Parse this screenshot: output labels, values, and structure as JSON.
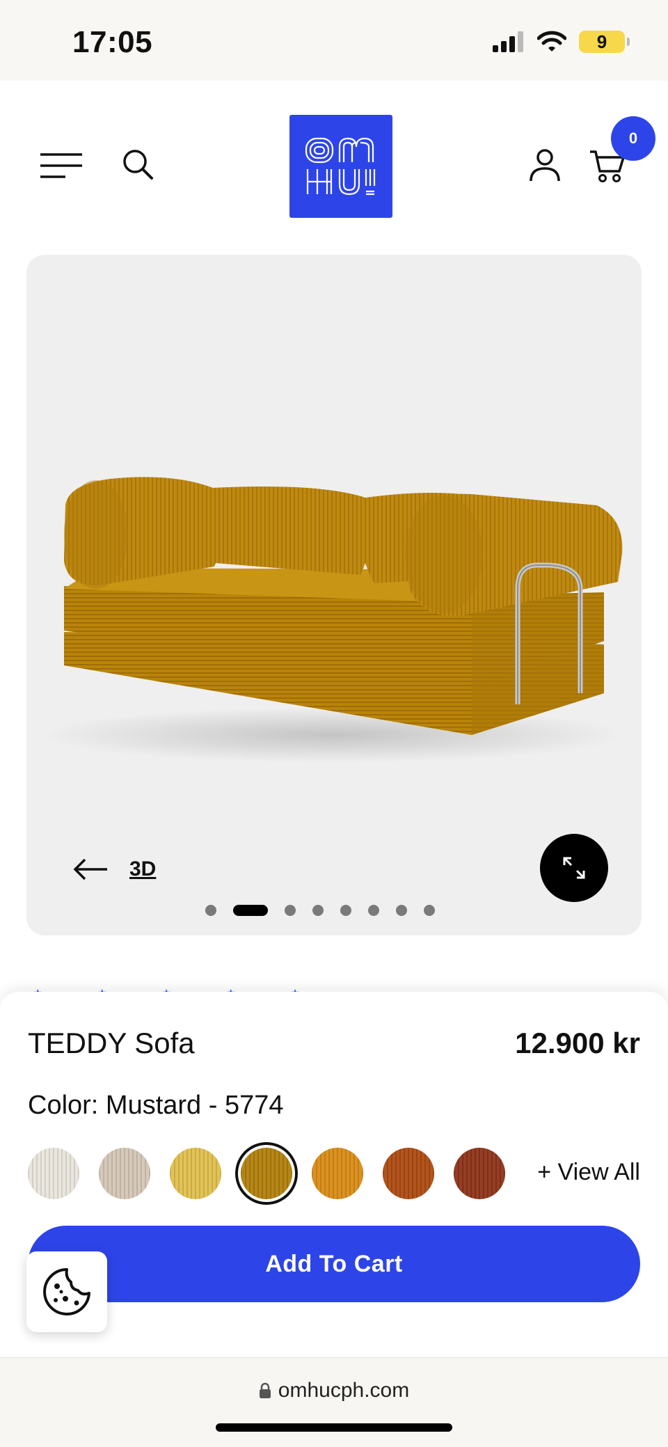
{
  "status_bar": {
    "time": "17:05",
    "battery": "9"
  },
  "header": {
    "cart_count": "0",
    "logo_alt": "OMHU!"
  },
  "gallery": {
    "link_3d": "3D",
    "total_images": 8,
    "active_index": 1
  },
  "rating_preview": "★ ★ ★ ★ ★",
  "product": {
    "name": "TEDDY Sofa",
    "price": "12.900 kr",
    "color_label": "Color: Mustard - 5774",
    "swatches": [
      {
        "name": "cream",
        "color": "#e9e5dc",
        "selected": false
      },
      {
        "name": "beige",
        "color": "#d4c6b6",
        "selected": false
      },
      {
        "name": "yellow",
        "color": "#e1c04e",
        "selected": false
      },
      {
        "name": "mustard",
        "color": "#b17f0c",
        "selected": true
      },
      {
        "name": "amber",
        "color": "#d98c16",
        "selected": false
      },
      {
        "name": "rust",
        "color": "#ae4b12",
        "selected": false
      },
      {
        "name": "brown",
        "color": "#8e3419",
        "selected": false
      }
    ],
    "view_all": "+ View All",
    "add_to_cart": "Add To Cart"
  },
  "browser": {
    "url": "omhucph.com"
  },
  "colors": {
    "brand_blue": "#2d45e8",
    "sofa": "#c08a10"
  }
}
